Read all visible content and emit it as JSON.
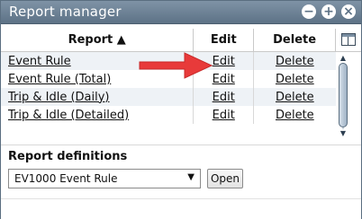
{
  "window": {
    "title": "Report manager",
    "minimize_glyph": "−",
    "maximize_glyph": "+",
    "close_glyph": "×"
  },
  "table": {
    "headers": {
      "report": "Report ▲",
      "edit": "Edit",
      "delete": "Delete"
    },
    "rows": [
      {
        "name": "Event Rule",
        "edit": "Edit",
        "delete": "Delete"
      },
      {
        "name": "Event Rule (Total)",
        "edit": "Edit",
        "delete": "Delete"
      },
      {
        "name": "Trip & Idle (Daily)",
        "edit": "Edit",
        "delete": "Delete"
      },
      {
        "name": "Trip & Idle (Detailed)",
        "edit": "Edit",
        "delete": "Delete"
      }
    ]
  },
  "definitions": {
    "title": "Report definitions",
    "selected": "EV1000 Event Rule",
    "open_label": "Open"
  },
  "colors": {
    "titlebar": "#6b7f93",
    "annotation_arrow": "#e83a3a",
    "row_stripe": "#eef2f6"
  }
}
